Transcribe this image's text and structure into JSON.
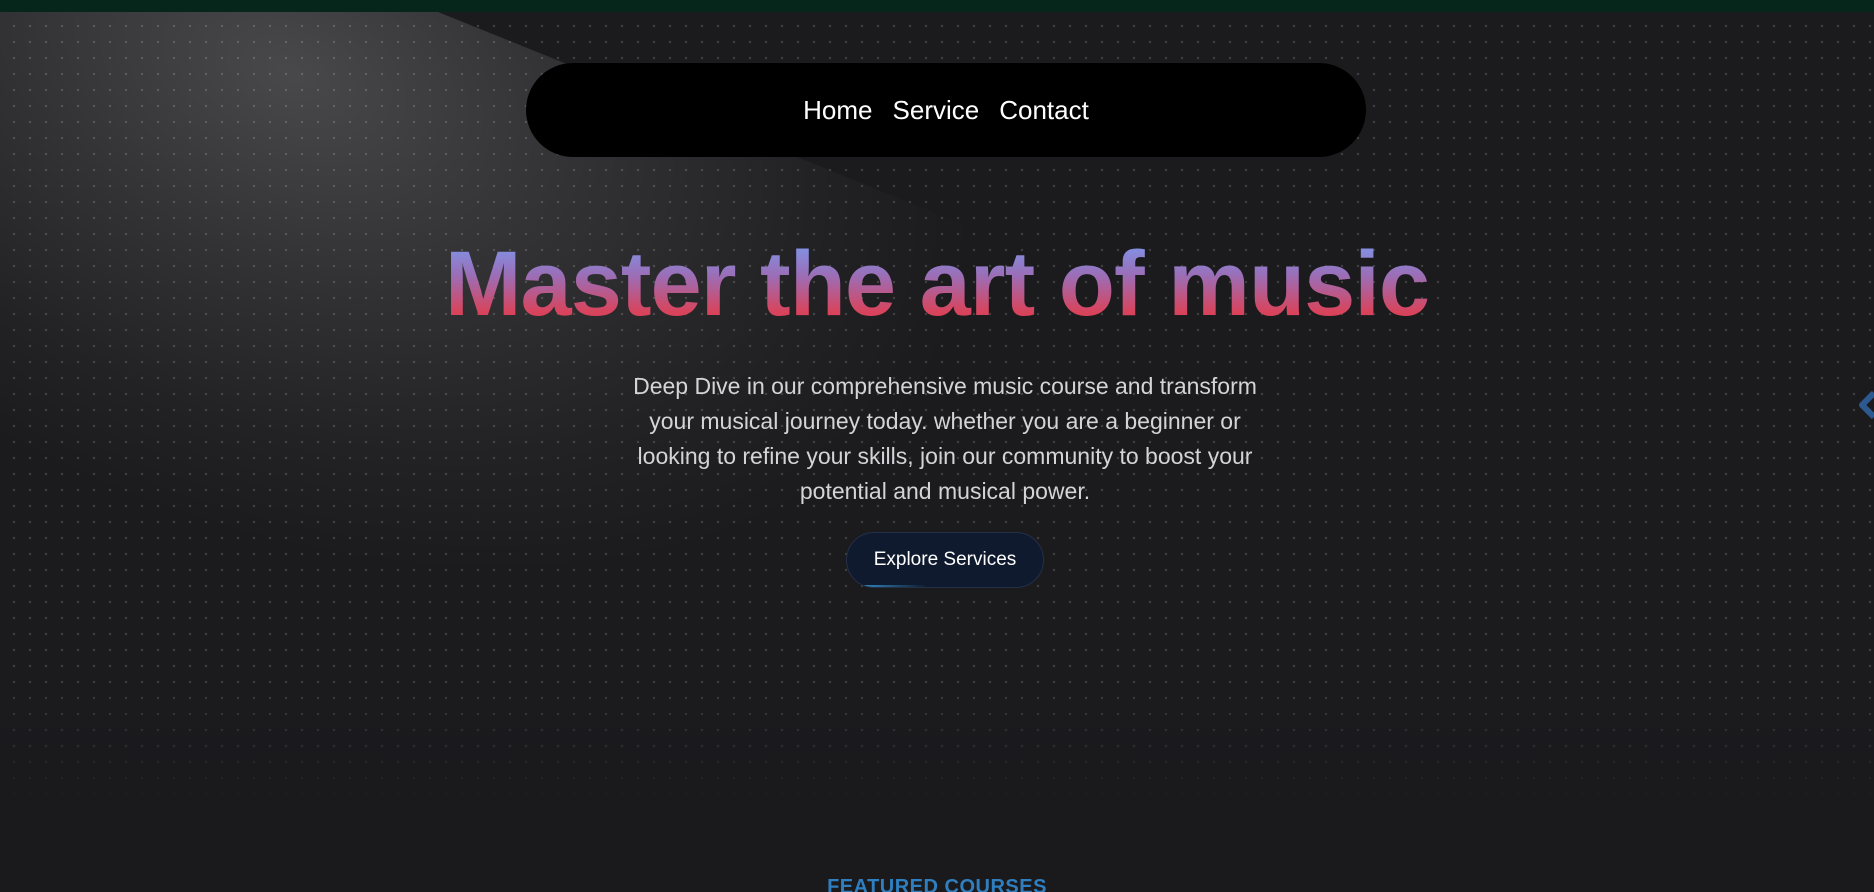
{
  "nav": {
    "links": [
      {
        "label": "Home"
      },
      {
        "label": "Service"
      },
      {
        "label": "Contact"
      }
    ]
  },
  "hero": {
    "title": "Master the art of music",
    "description": "Deep Dive in our comprehensive music course and transform your musical journey today. whether you are a beginner or looking to refine your skills, join our community to boost your potential and musical power.",
    "cta_label": "Explore Services"
  },
  "featured": {
    "label": "FEATURED COURSES"
  },
  "icons": {
    "edge": "chevron-left-icon"
  },
  "colors": {
    "top_strip": "#06261c",
    "background": "#1a1a1d",
    "navbar": "#000000",
    "title_gradient_top": "#7a9cf0",
    "title_gradient_bottom": "#d83a55",
    "cta_background": "#0f1a2e",
    "section_label": "#2f7fc0"
  }
}
